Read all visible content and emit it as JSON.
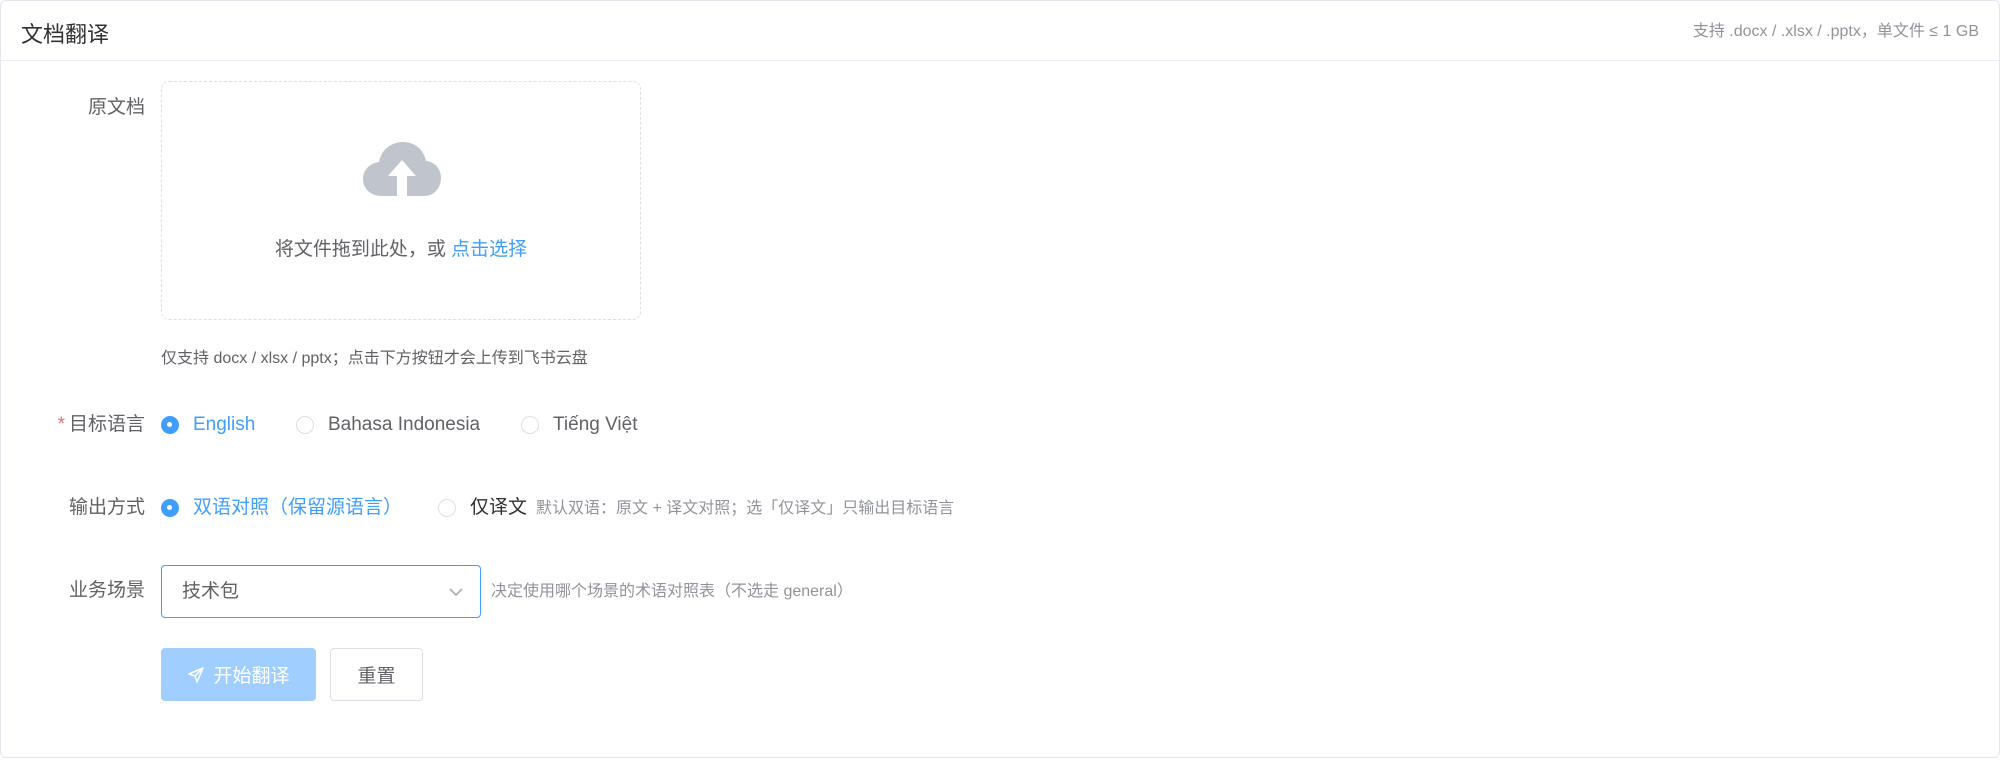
{
  "header": {
    "title": "文档翻译",
    "hint": "支持 .docx / .xlsx / .pptx，单文件 ≤ 1 GB"
  },
  "upload": {
    "label": "原文档",
    "drop_text": "将文件拖到此处，或 ",
    "drop_link": "点击选择",
    "tip": "仅支持 docx / xlsx / pptx；点击下方按钮才会上传到飞书云盘",
    "icon": "cloud-upload-icon"
  },
  "target_language": {
    "required_mark": "*",
    "label": "目标语言",
    "options": [
      {
        "label": "English",
        "checked": true
      },
      {
        "label": "Bahasa Indonesia",
        "checked": false
      },
      {
        "label": "Tiếng Việt",
        "checked": false
      }
    ]
  },
  "output_mode": {
    "label": "输出方式",
    "options": [
      {
        "label": "双语对照（保留源语言）",
        "checked": true
      },
      {
        "label": "仅译文",
        "checked": false
      }
    ],
    "hint": "默认双语：原文 + 译文对照；选「仅译文」只输出目标语言"
  },
  "scenario": {
    "label": "业务场景",
    "selected": "技术包",
    "hint": "决定使用哪个场景的术语对照表（不选走 general）"
  },
  "actions": {
    "start_label": "开始翻译",
    "reset_label": "重置"
  },
  "colors": {
    "accent": "#409eff",
    "accent_disabled": "#a0cfff",
    "required": "#f56c6c",
    "text_secondary": "#909399"
  }
}
